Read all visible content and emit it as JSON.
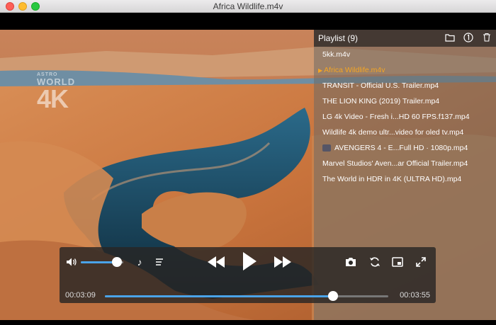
{
  "window": {
    "title": "Africa Wildlife.m4v"
  },
  "watermark": {
    "line1": "ASTRO",
    "line2": "WORLD",
    "line3": "4K"
  },
  "playlist": {
    "title": "Playlist (9)",
    "tools": {
      "open_icon": "folder-icon",
      "info_icon": "info-icon",
      "delete_icon": "trash-icon"
    },
    "items": [
      {
        "label": "5kk.m4v",
        "active": false
      },
      {
        "label": "Africa Wildlife.m4v",
        "active": true
      },
      {
        "label": "TRANSIT - Official U.S. Trailer.mp4",
        "active": false
      },
      {
        "label": "THE LION KING (2019) Trailer.mp4",
        "active": false
      },
      {
        "label": "LG 4k Video - Fresh i...HD 60 FPS.f137.mp4",
        "active": false
      },
      {
        "label": "Wildlife 4k demo ultr...video for oled tv.mp4",
        "active": false
      },
      {
        "label": "AVENGERS 4 - E...Full HD · 1080p.mp4",
        "active": false
      },
      {
        "label": "Marvel Studios' Aven...ar Official Trailer.mp4",
        "active": false
      },
      {
        "label": "The World in HDR in 4K (ULTRA HD).mp4",
        "active": false
      }
    ]
  },
  "controls": {
    "current_time": "00:03:09",
    "duration": "00:03:55",
    "volume_fraction": 0.85,
    "progress_fraction": 0.805,
    "accent_color": "#4aa3e8"
  }
}
